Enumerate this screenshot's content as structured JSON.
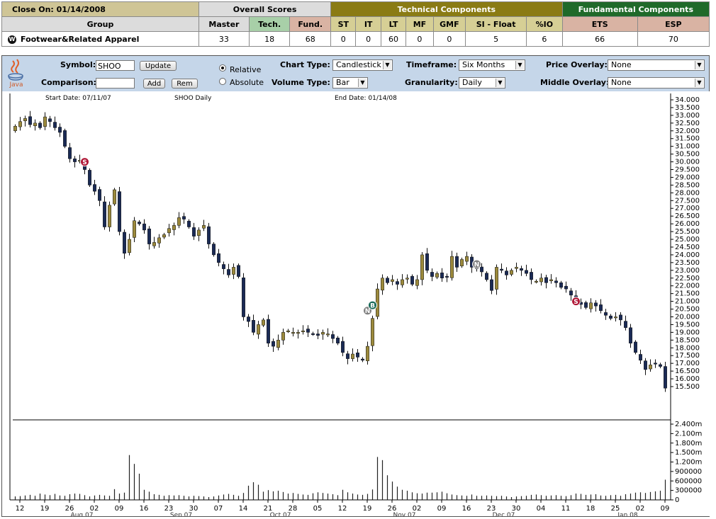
{
  "scores": {
    "close_on": "Close On: 01/14/2008",
    "overall_header": "Overall Scores",
    "technical_header": "Technical Components",
    "fundamental_header": "Fundamental Components",
    "columns": [
      "Group",
      "Master",
      "Tech.",
      "Fund.",
      "ST",
      "IT",
      "LT",
      "MF",
      "GMF",
      "SI - Float",
      "%IO",
      "ETS",
      "ESP"
    ],
    "row": {
      "icon": "W",
      "group": "Footwear&Related Apparel",
      "values": [
        "33",
        "18",
        "68",
        "0",
        "0",
        "60",
        "0",
        "0",
        "5",
        "6",
        "66",
        "70"
      ]
    }
  },
  "controls": {
    "java_label": "Java",
    "symbol_label": "Symbol:",
    "symbol_value": "SHOO",
    "update_label": "Update",
    "comparison_label": "Comparison:",
    "comparison_value": "",
    "add_label": "Add",
    "rem_label": "Rem",
    "relative_label": "Relative",
    "absolute_label": "Absolute",
    "chart_type_label": "Chart Type:",
    "chart_type_value": "Candlestick",
    "volume_type_label": "Volume Type:",
    "volume_type_value": "Bar",
    "timeframe_label": "Timeframe:",
    "timeframe_value": "Six Months",
    "granularity_label": "Granularity:",
    "granularity_value": "Daily",
    "price_overlay_label": "Price Overlay:",
    "price_overlay_value": "None",
    "middle_overlay_label": "Middle Overlay:",
    "middle_overlay_value": "None"
  },
  "chart_info": {
    "start_date": "Start Date:  07/11/07",
    "title": "SHOO Daily",
    "end_date": "End Date: 01/14/08"
  },
  "chart_data": {
    "type": "candlestick",
    "price_ticks": [
      "34.000",
      "33.500",
      "33.000",
      "32.500",
      "32.000",
      "31.500",
      "31.000",
      "30.500",
      "30.000",
      "29.500",
      "29.000",
      "28.500",
      "28.000",
      "27.500",
      "27.000",
      "26.500",
      "26.000",
      "25.500",
      "25.000",
      "24.500",
      "24.000",
      "23.500",
      "23.000",
      "22.500",
      "22.000",
      "21.500",
      "21.000",
      "20.500",
      "20.000",
      "19.500",
      "19.000",
      "18.500",
      "18.000",
      "17.500",
      "17.000",
      "16.500",
      "16.000",
      "15.500"
    ],
    "price_range": [
      15.5,
      34.0
    ],
    "volume_ticks": [
      "2.400m",
      "2.100m",
      "1.800m",
      "1.500m",
      "1.200m",
      "900000",
      "600000",
      "300000",
      "0"
    ],
    "volume_range": [
      0,
      2400000
    ],
    "x_day_labels": [
      "12",
      "19",
      "26",
      "02",
      "09",
      "16",
      "23",
      "30",
      "07",
      "14",
      "21",
      "28",
      "05",
      "12",
      "19",
      "26",
      "02",
      "09",
      "16",
      "23",
      "30",
      "04",
      "11",
      "18",
      "25",
      "02",
      "09"
    ],
    "x_month_labels": [
      {
        "label": "Aug 07",
        "at_day": 3
      },
      {
        "label": "Sep 07",
        "at_day": 7
      },
      {
        "label": "Oct 07",
        "at_day": 11
      },
      {
        "label": "Nov 07",
        "at_day": 16
      },
      {
        "label": "Dec 07",
        "at_day": 20
      },
      {
        "label": "Jan 08",
        "at_day": 25
      }
    ],
    "colors": {
      "up": "#9c8a3c",
      "down": "#1a2a55",
      "volume": "#222222",
      "sell_marker": "#b01837",
      "buy_marker": "#1a6b5a",
      "neutral_marker": "#808080"
    },
    "markers": [
      {
        "type": "S",
        "idx": 14,
        "price": 30.0
      },
      {
        "type": "N",
        "idx": 71,
        "price": 20.4
      },
      {
        "type": "B",
        "idx": 72,
        "price": 20.75
      },
      {
        "type": "N",
        "idx": 93,
        "price": 23.4
      },
      {
        "type": "S",
        "idx": 113,
        "price": 21.0
      }
    ],
    "closes": [
      32.3,
      32.6,
      32.8,
      32.4,
      32.5,
      32.2,
      32.9,
      32.6,
      32.2,
      31.9,
      31.0,
      30.2,
      30.0,
      30.1,
      29.5,
      28.5,
      28.1,
      27.5,
      25.8,
      27.2,
      28.2,
      25.5,
      24.1,
      25.0,
      26.2,
      26.0,
      25.6,
      24.7,
      24.8,
      25.1,
      25.3,
      25.7,
      25.9,
      26.4,
      26.3,
      25.8,
      25.2,
      25.6,
      25.9,
      24.7,
      24.0,
      23.5,
      23.1,
      22.7,
      23.2,
      22.6,
      20.0,
      19.7,
      19.0,
      19.5,
      19.8,
      18.3,
      18.1,
      18.5,
      19.0,
      19.1,
      19.0,
      19.0,
      19.1,
      19.0,
      18.9,
      18.8,
      19.0,
      18.9,
      18.6,
      18.3,
      17.7,
      17.3,
      17.6,
      17.4,
      17.2,
      18.1,
      19.9,
      21.8,
      22.5,
      22.2,
      22.4,
      22.1,
      22.4,
      22.5,
      22.1,
      22.4,
      24.0,
      23.0,
      22.6,
      22.8,
      22.5,
      22.6,
      23.9,
      23.2,
      23.7,
      23.9,
      23.2,
      23.1,
      22.9,
      22.4,
      21.7,
      23.2,
      23.0,
      22.7,
      23.0,
      23.2,
      23.0,
      22.8,
      22.4,
      22.3,
      22.5,
      22.2,
      22.4,
      22.2,
      21.9,
      21.8,
      21.4,
      20.9,
      20.8,
      20.6,
      20.9,
      20.7,
      20.4,
      20.1,
      19.9,
      20.0,
      19.8,
      19.3,
      18.3,
      17.7,
      17.2,
      16.6,
      16.9,
      17.0,
      16.8,
      15.4
    ],
    "volumes": [
      110000,
      120000,
      140000,
      160000,
      130000,
      200000,
      170000,
      150000,
      190000,
      140000,
      130000,
      180000,
      200000,
      190000,
      150000,
      110000,
      140000,
      160000,
      140000,
      130000,
      340000,
      200000,
      230000,
      1420000,
      1140000,
      830000,
      320000,
      260000,
      180000,
      160000,
      130000,
      150000,
      140000,
      150000,
      130000,
      110000,
      130000,
      120000,
      110000,
      90000,
      110000,
      140000,
      170000,
      190000,
      160000,
      130000,
      220000,
      450000,
      560000,
      480000,
      260000,
      310000,
      270000,
      290000,
      250000,
      200000,
      220000,
      190000,
      170000,
      160000,
      210000,
      240000,
      220000,
      200000,
      180000,
      150000,
      320000,
      240000,
      200000,
      170000,
      160000,
      190000,
      330000,
      1360000,
      1260000,
      780000,
      580000,
      420000,
      320000,
      290000,
      240000,
      210000,
      200000,
      230000,
      230000,
      240000,
      260000,
      210000,
      170000,
      150000,
      140000,
      130000,
      170000,
      130000,
      130000,
      140000,
      130000,
      120000,
      130000,
      110000,
      90000,
      110000,
      120000,
      130000,
      160000,
      170000,
      150000,
      130000,
      140000,
      150000,
      130000,
      120000,
      150000,
      200000,
      190000,
      160000,
      170000,
      180000,
      140000,
      130000,
      150000,
      160000,
      130000,
      180000,
      200000,
      230000,
      240000,
      220000,
      250000,
      270000,
      290000,
      640000
    ]
  }
}
